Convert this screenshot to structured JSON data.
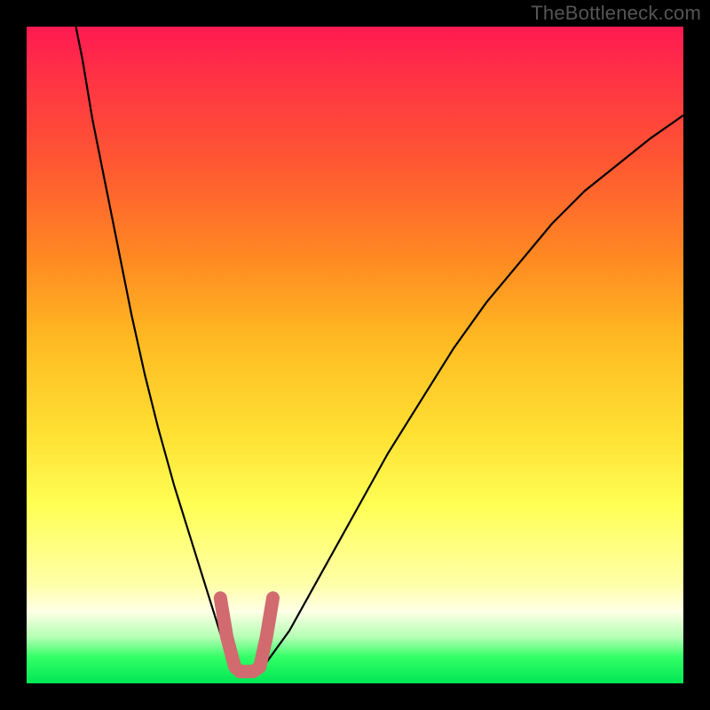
{
  "watermark": "TheBottleneck.com",
  "colors": {
    "background_outer": "#000000",
    "gradient_top": "#ff1a52",
    "gradient_bottom": "#00e655",
    "curve": "#000000",
    "overlay": "#d16b6f"
  },
  "chart_data": {
    "type": "line",
    "title": "",
    "xlabel": "",
    "ylabel": "",
    "xlim": [
      0,
      1
    ],
    "ylim": [
      0,
      1
    ],
    "series": [
      {
        "name": "left-curve",
        "x": [
          0.075,
          0.085,
          0.1,
          0.12,
          0.14,
          0.16,
          0.18,
          0.2,
          0.225,
          0.25,
          0.275,
          0.3,
          0.317
        ],
        "y": [
          1.0,
          0.95,
          0.86,
          0.76,
          0.66,
          0.56,
          0.47,
          0.39,
          0.3,
          0.22,
          0.14,
          0.06,
          0.018
        ]
      },
      {
        "name": "right-curve",
        "x": [
          0.355,
          0.4,
          0.45,
          0.5,
          0.55,
          0.6,
          0.65,
          0.7,
          0.75,
          0.8,
          0.85,
          0.9,
          0.95,
          1.0
        ],
        "y": [
          0.018,
          0.08,
          0.17,
          0.26,
          0.35,
          0.43,
          0.51,
          0.58,
          0.64,
          0.7,
          0.75,
          0.79,
          0.83,
          0.865
        ]
      },
      {
        "name": "pink-overlay",
        "x": [
          0.295,
          0.305,
          0.317,
          0.325,
          0.335,
          0.345,
          0.355,
          0.365,
          0.375
        ],
        "y": [
          0.13,
          0.07,
          0.025,
          0.018,
          0.018,
          0.018,
          0.025,
          0.07,
          0.13
        ]
      }
    ],
    "annotations": []
  }
}
